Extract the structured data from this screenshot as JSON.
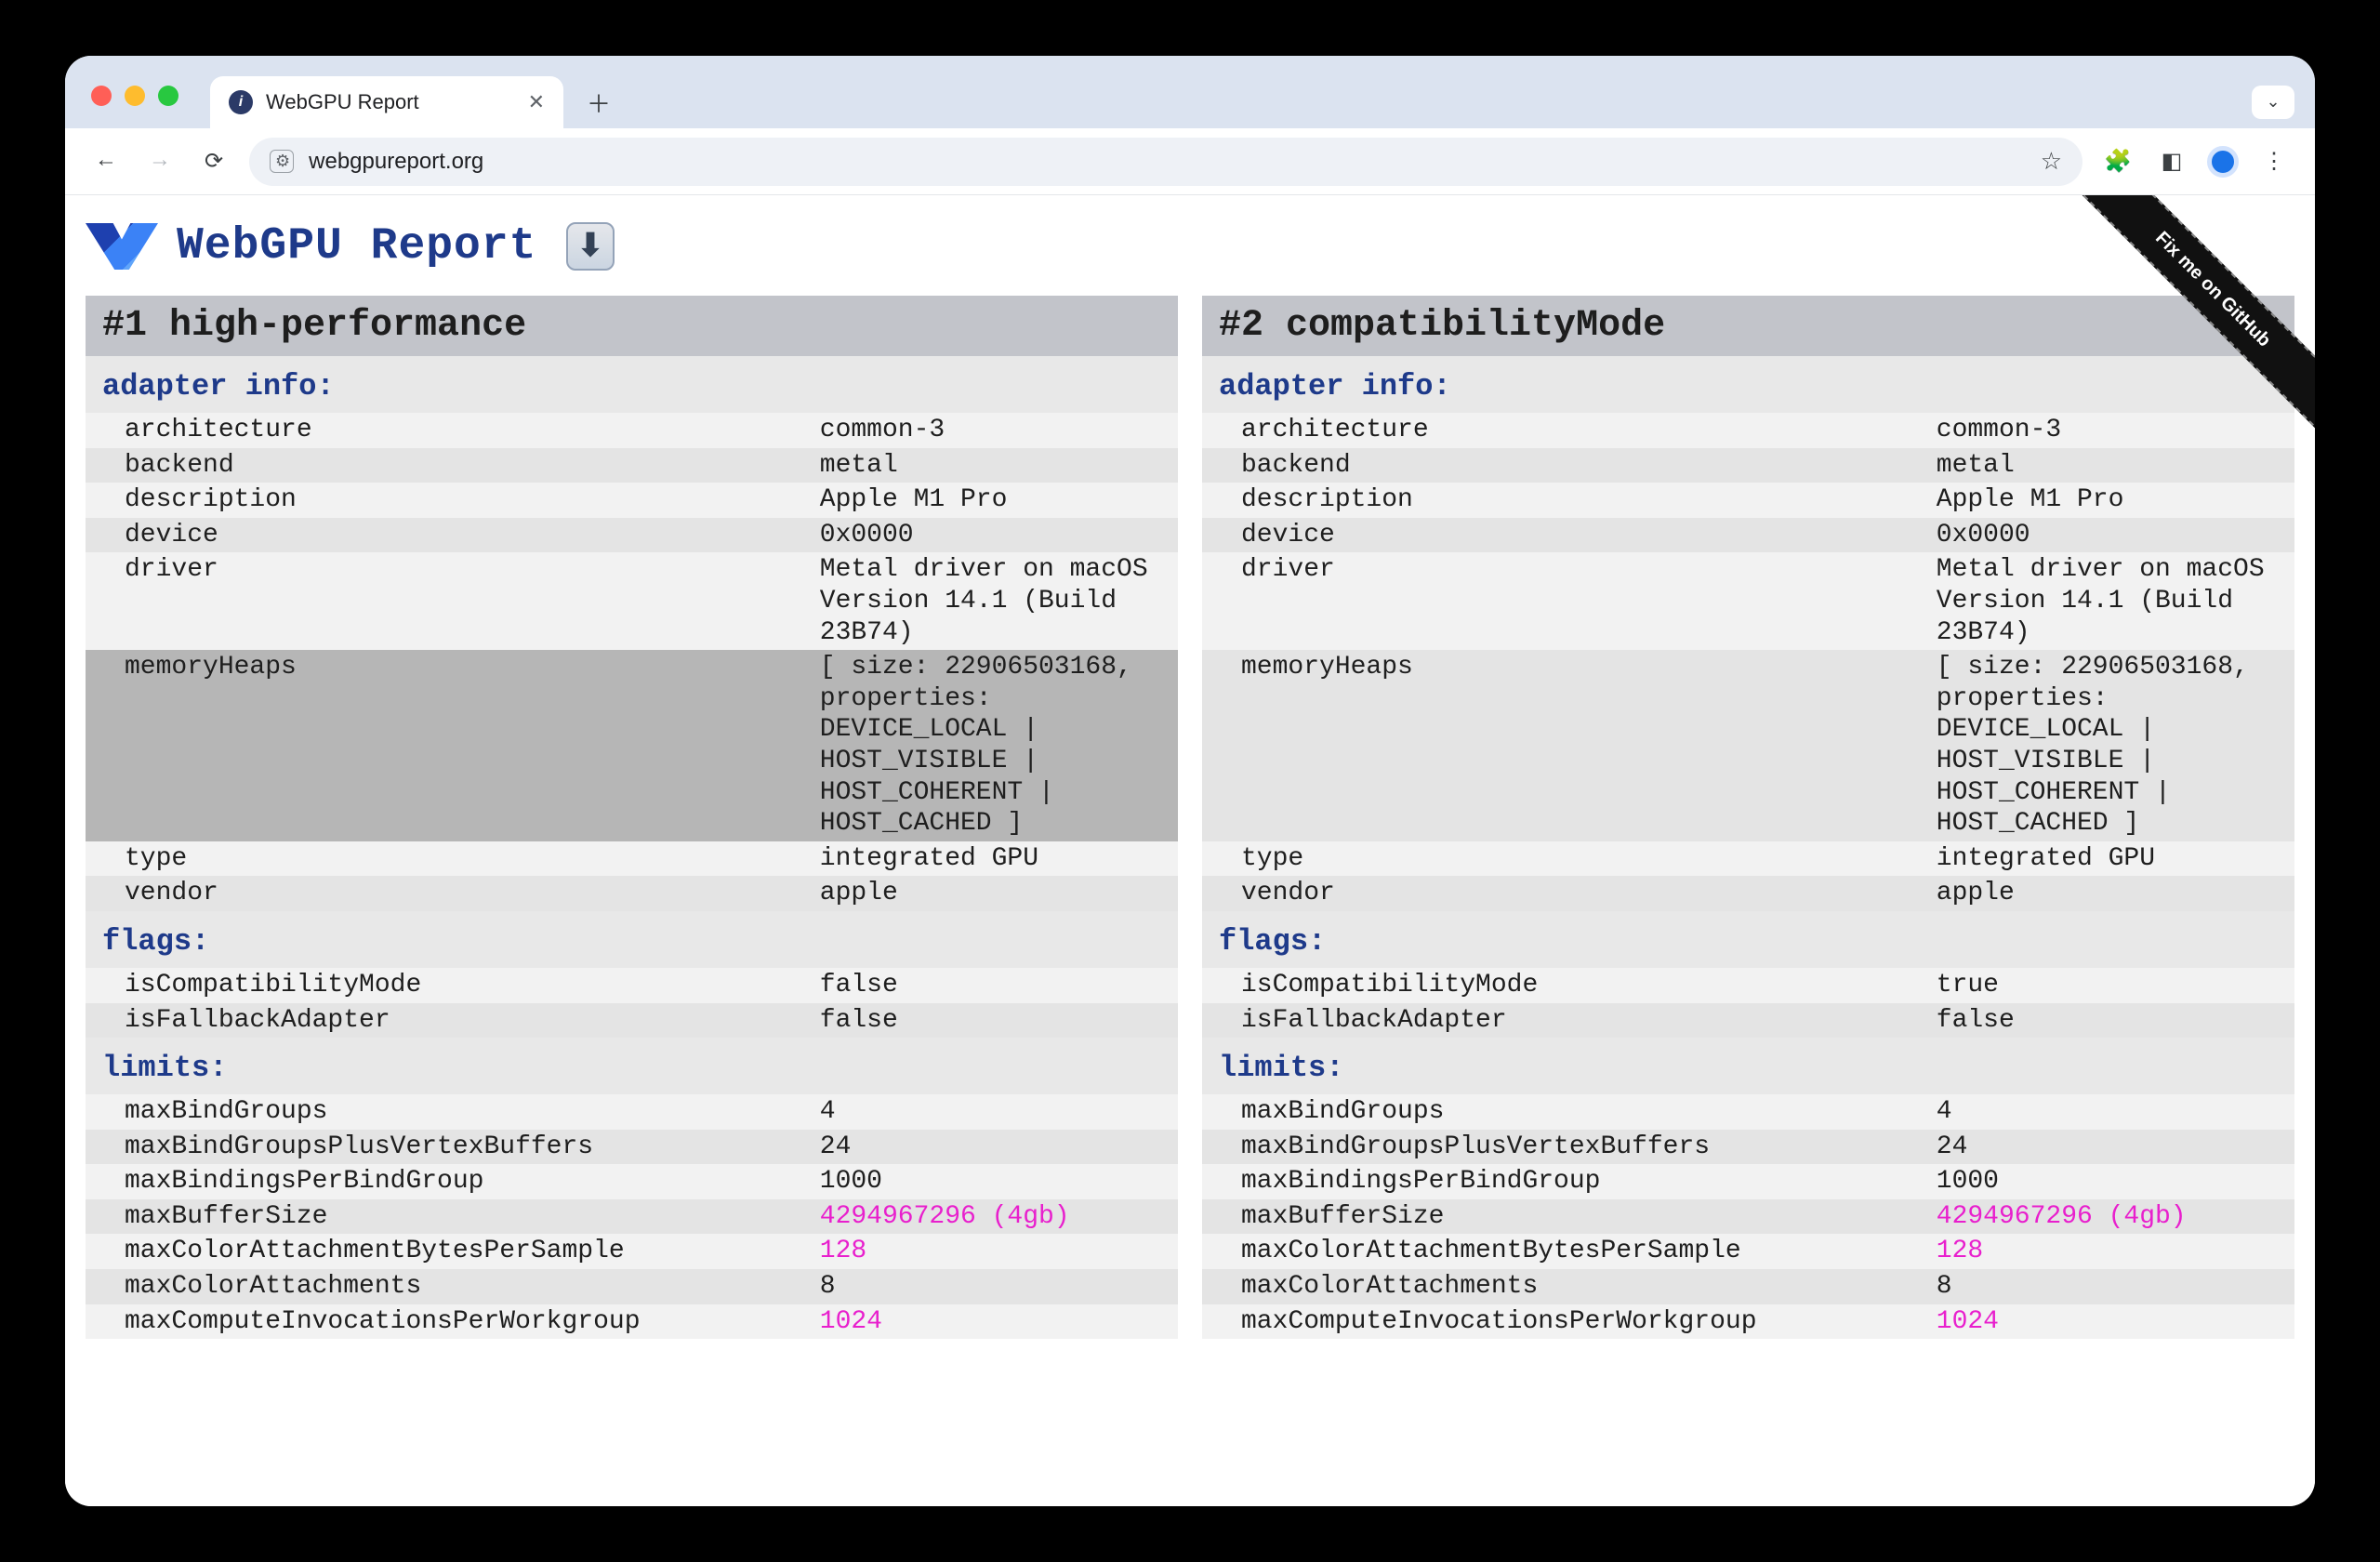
{
  "browser": {
    "tab_title": "WebGPU Report",
    "url": "webgpureport.org"
  },
  "page": {
    "title": "WebGPU Report",
    "download_icon": "⬇",
    "ribbon": "Fix me on GitHub"
  },
  "columns": [
    {
      "heading": "#1 high-performance",
      "adapter_info_label": "adapter info:",
      "adapter_info": [
        {
          "k": "architecture",
          "v": "common-3"
        },
        {
          "k": "backend",
          "v": "metal"
        },
        {
          "k": "description",
          "v": "Apple M1 Pro"
        },
        {
          "k": "device",
          "v": "0x0000"
        },
        {
          "k": "driver",
          "v": "Metal driver on macOS Version 14.1 (Build 23B74)"
        },
        {
          "k": "memoryHeaps",
          "v": "[ size: 22906503168, properties: DEVICE_LOCAL | HOST_VISIBLE | HOST_COHERENT | HOST_CACHED ]",
          "highlight": true
        },
        {
          "k": "type",
          "v": "integrated GPU"
        },
        {
          "k": "vendor",
          "v": "apple"
        }
      ],
      "flags_label": "flags:",
      "flags": [
        {
          "k": "isCompatibilityMode",
          "v": "false"
        },
        {
          "k": "isFallbackAdapter",
          "v": "false"
        }
      ],
      "limits_label": "limits:",
      "limits": [
        {
          "k": "maxBindGroups",
          "v": "4"
        },
        {
          "k": "maxBindGroupsPlusVertexBuffers",
          "v": "24"
        },
        {
          "k": "maxBindingsPerBindGroup",
          "v": "1000"
        },
        {
          "k": "maxBufferSize",
          "v": "4294967296 (4gb)",
          "diff": true
        },
        {
          "k": "maxColorAttachmentBytesPerSample",
          "v": "128",
          "diff": true
        },
        {
          "k": "maxColorAttachments",
          "v": "8"
        },
        {
          "k": "maxComputeInvocationsPerWorkgroup",
          "v": "1024",
          "diff": true
        }
      ]
    },
    {
      "heading": "#2 compatibilityMode",
      "adapter_info_label": "adapter info:",
      "adapter_info": [
        {
          "k": "architecture",
          "v": "common-3"
        },
        {
          "k": "backend",
          "v": "metal"
        },
        {
          "k": "description",
          "v": "Apple M1 Pro"
        },
        {
          "k": "device",
          "v": "0x0000"
        },
        {
          "k": "driver",
          "v": "Metal driver on macOS Version 14.1 (Build 23B74)"
        },
        {
          "k": "memoryHeaps",
          "v": "[ size: 22906503168, properties: DEVICE_LOCAL | HOST_VISIBLE | HOST_COHERENT | HOST_CACHED ]"
        },
        {
          "k": "type",
          "v": "integrated GPU"
        },
        {
          "k": "vendor",
          "v": "apple"
        }
      ],
      "flags_label": "flags:",
      "flags": [
        {
          "k": "isCompatibilityMode",
          "v": "true"
        },
        {
          "k": "isFallbackAdapter",
          "v": "false"
        }
      ],
      "limits_label": "limits:",
      "limits": [
        {
          "k": "maxBindGroups",
          "v": "4"
        },
        {
          "k": "maxBindGroupsPlusVertexBuffers",
          "v": "24"
        },
        {
          "k": "maxBindingsPerBindGroup",
          "v": "1000"
        },
        {
          "k": "maxBufferSize",
          "v": "4294967296 (4gb)",
          "diff": true
        },
        {
          "k": "maxColorAttachmentBytesPerSample",
          "v": "128",
          "diff": true
        },
        {
          "k": "maxColorAttachments",
          "v": "8"
        },
        {
          "k": "maxComputeInvocationsPerWorkgroup",
          "v": "1024",
          "diff": true
        }
      ]
    }
  ]
}
